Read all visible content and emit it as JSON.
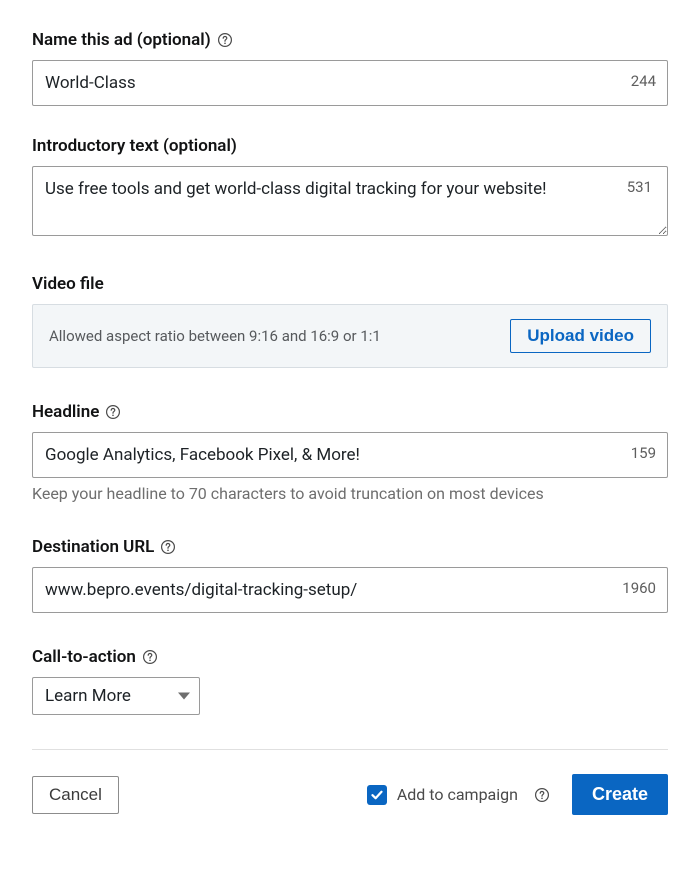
{
  "name_field": {
    "label": "Name this ad (optional)",
    "value": "World-Class",
    "remaining": "244"
  },
  "intro_field": {
    "label": "Introductory text (optional)",
    "value": "Use free tools and get world-class digital tracking for your website!",
    "remaining": "531"
  },
  "video_field": {
    "label": "Video file",
    "hint": "Allowed aspect ratio between 9:16 and 16:9 or 1:1",
    "upload_label": "Upload video"
  },
  "headline_field": {
    "label": "Headline",
    "value": "Google Analytics, Facebook Pixel, & More!",
    "remaining": "159",
    "hint": "Keep your headline to 70 characters to avoid truncation on most devices"
  },
  "destination_field": {
    "label": "Destination URL",
    "value": "www.bepro.events/digital-tracking-setup/",
    "remaining": "1960"
  },
  "cta_field": {
    "label": "Call-to-action",
    "selected": "Learn More"
  },
  "footer": {
    "cancel_label": "Cancel",
    "add_to_campaign_label": "Add to campaign",
    "create_label": "Create"
  }
}
